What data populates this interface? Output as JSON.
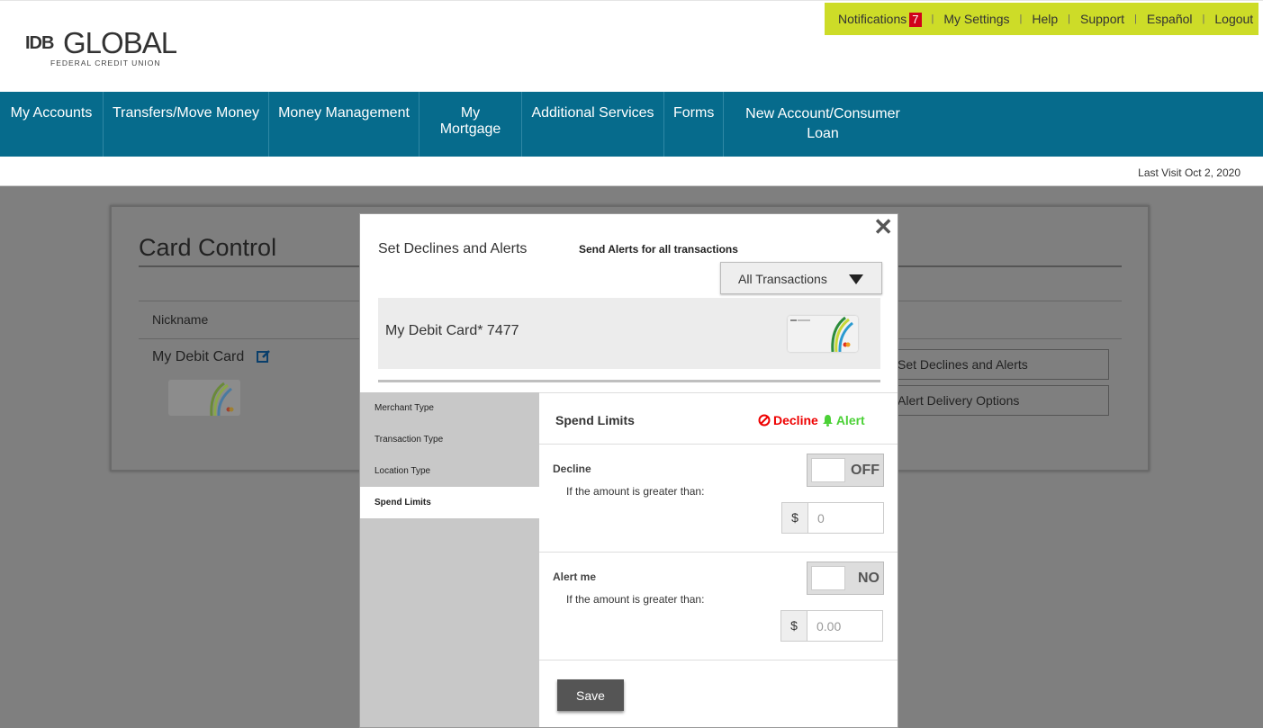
{
  "logo": {
    "idb": "IDB",
    "global": "GLOBAL",
    "subtitle": "FEDERAL CREDIT UNION"
  },
  "toplinks": {
    "notifications": "Notifications",
    "notification_count": "7",
    "settings": "My Settings",
    "help": "Help",
    "support": "Support",
    "espanol": "Español",
    "logout": "Logout"
  },
  "nav": {
    "items": [
      "My Accounts",
      "Transfers/Move Money",
      "Money Management",
      "My Mortgage",
      "Additional Services",
      "Forms",
      "New Account/Consumer Loan"
    ]
  },
  "last_visit": "Last Visit Oct 2, 2020",
  "card_control": {
    "title": "Card Control",
    "nickname_header": "Nickname",
    "nickname_value": "My Debit Card",
    "btn_declines": "Set Declines and Alerts",
    "btn_delivery": "Alert Delivery Options"
  },
  "modal": {
    "title": "Set Declines and Alerts",
    "send_alerts": "Send Alerts for all transactions",
    "select_value": "All Transactions",
    "card_name": "My Debit Card* 7477",
    "sidebar": [
      "Merchant Type",
      "Transaction Type",
      "Location Type",
      "Spend Limits"
    ],
    "section_title": "Spend Limits",
    "legend_decline": "Decline",
    "legend_alert": "Alert",
    "decline": {
      "label": "Decline",
      "sub": "If the amount is greater than:",
      "toggle": "OFF",
      "currency": "$",
      "placeholder": "0"
    },
    "alert": {
      "label": "Alert me",
      "sub": "If the amount is greater than:",
      "toggle": "NO",
      "currency": "$",
      "placeholder": "0.00"
    },
    "save": "Save"
  }
}
